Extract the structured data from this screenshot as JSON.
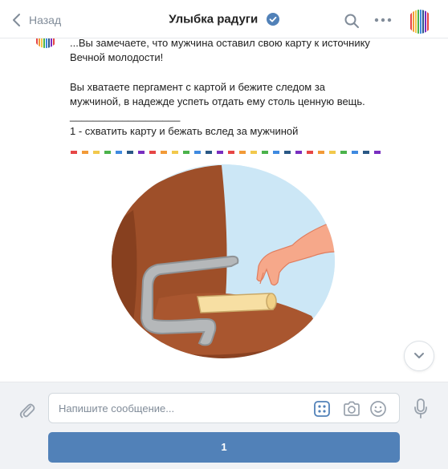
{
  "header": {
    "back_label": "Назад",
    "title": "Улыбка радуги",
    "verified_icon": "verified-check-icon",
    "search_icon": "search-icon",
    "more_icon": "more-dots-icon"
  },
  "message": {
    "text": "...Вы замечаете, что мужчина оставил свою карту к источнику\nВечной молодости!\n\nВы хватаете пергамент с картой и бежите следом за\nмужчиной, в надежде успеть отдать ему столь ценную вещь.\n___________________\n1 - схватить карту и бежать вслед за мужчиной"
  },
  "divider_colors": [
    "#e64646",
    "#f29a38",
    "#f2c94c",
    "#4bb34b",
    "#3f8ae0",
    "#2a5885",
    "#792ec0",
    "#e64646",
    "#f29a38",
    "#f2c94c",
    "#4bb34b",
    "#3f8ae0",
    "#2a5885",
    "#792ec0"
  ],
  "composer": {
    "placeholder": "Напишите сообщение...",
    "value": "",
    "keyboard_button_label": "1"
  },
  "colors": {
    "accent": "#5181b8",
    "muted": "#818c99",
    "verified": "#5181b8"
  }
}
